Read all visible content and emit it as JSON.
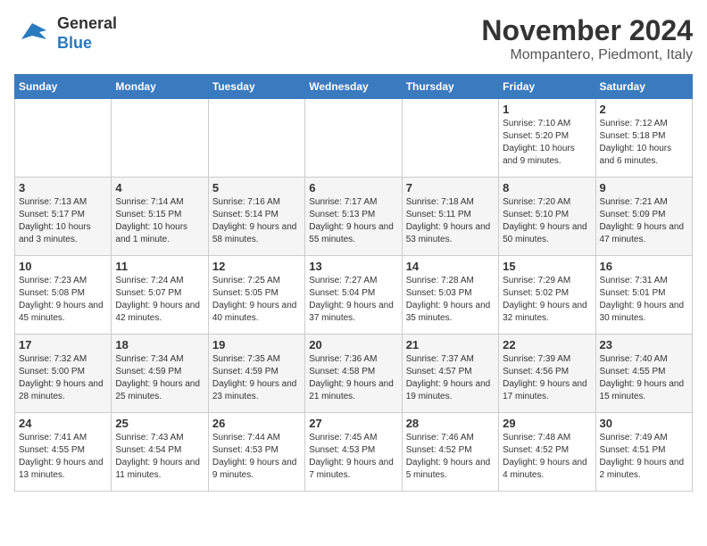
{
  "header": {
    "logo_general": "General",
    "logo_blue": "Blue",
    "month_title": "November 2024",
    "location": "Mompantero, Piedmont, Italy"
  },
  "days_of_week": [
    "Sunday",
    "Monday",
    "Tuesday",
    "Wednesday",
    "Thursday",
    "Friday",
    "Saturday"
  ],
  "weeks": [
    {
      "days": [
        {
          "num": "",
          "info": ""
        },
        {
          "num": "",
          "info": ""
        },
        {
          "num": "",
          "info": ""
        },
        {
          "num": "",
          "info": ""
        },
        {
          "num": "",
          "info": ""
        },
        {
          "num": "1",
          "info": "Sunrise: 7:10 AM\nSunset: 5:20 PM\nDaylight: 10 hours and 9 minutes."
        },
        {
          "num": "2",
          "info": "Sunrise: 7:12 AM\nSunset: 5:18 PM\nDaylight: 10 hours and 6 minutes."
        }
      ]
    },
    {
      "days": [
        {
          "num": "3",
          "info": "Sunrise: 7:13 AM\nSunset: 5:17 PM\nDaylight: 10 hours and 3 minutes."
        },
        {
          "num": "4",
          "info": "Sunrise: 7:14 AM\nSunset: 5:15 PM\nDaylight: 10 hours and 1 minute."
        },
        {
          "num": "5",
          "info": "Sunrise: 7:16 AM\nSunset: 5:14 PM\nDaylight: 9 hours and 58 minutes."
        },
        {
          "num": "6",
          "info": "Sunrise: 7:17 AM\nSunset: 5:13 PM\nDaylight: 9 hours and 55 minutes."
        },
        {
          "num": "7",
          "info": "Sunrise: 7:18 AM\nSunset: 5:11 PM\nDaylight: 9 hours and 53 minutes."
        },
        {
          "num": "8",
          "info": "Sunrise: 7:20 AM\nSunset: 5:10 PM\nDaylight: 9 hours and 50 minutes."
        },
        {
          "num": "9",
          "info": "Sunrise: 7:21 AM\nSunset: 5:09 PM\nDaylight: 9 hours and 47 minutes."
        }
      ]
    },
    {
      "days": [
        {
          "num": "10",
          "info": "Sunrise: 7:23 AM\nSunset: 5:08 PM\nDaylight: 9 hours and 45 minutes."
        },
        {
          "num": "11",
          "info": "Sunrise: 7:24 AM\nSunset: 5:07 PM\nDaylight: 9 hours and 42 minutes."
        },
        {
          "num": "12",
          "info": "Sunrise: 7:25 AM\nSunset: 5:05 PM\nDaylight: 9 hours and 40 minutes."
        },
        {
          "num": "13",
          "info": "Sunrise: 7:27 AM\nSunset: 5:04 PM\nDaylight: 9 hours and 37 minutes."
        },
        {
          "num": "14",
          "info": "Sunrise: 7:28 AM\nSunset: 5:03 PM\nDaylight: 9 hours and 35 minutes."
        },
        {
          "num": "15",
          "info": "Sunrise: 7:29 AM\nSunset: 5:02 PM\nDaylight: 9 hours and 32 minutes."
        },
        {
          "num": "16",
          "info": "Sunrise: 7:31 AM\nSunset: 5:01 PM\nDaylight: 9 hours and 30 minutes."
        }
      ]
    },
    {
      "days": [
        {
          "num": "17",
          "info": "Sunrise: 7:32 AM\nSunset: 5:00 PM\nDaylight: 9 hours and 28 minutes."
        },
        {
          "num": "18",
          "info": "Sunrise: 7:34 AM\nSunset: 4:59 PM\nDaylight: 9 hours and 25 minutes."
        },
        {
          "num": "19",
          "info": "Sunrise: 7:35 AM\nSunset: 4:59 PM\nDaylight: 9 hours and 23 minutes."
        },
        {
          "num": "20",
          "info": "Sunrise: 7:36 AM\nSunset: 4:58 PM\nDaylight: 9 hours and 21 minutes."
        },
        {
          "num": "21",
          "info": "Sunrise: 7:37 AM\nSunset: 4:57 PM\nDaylight: 9 hours and 19 minutes."
        },
        {
          "num": "22",
          "info": "Sunrise: 7:39 AM\nSunset: 4:56 PM\nDaylight: 9 hours and 17 minutes."
        },
        {
          "num": "23",
          "info": "Sunrise: 7:40 AM\nSunset: 4:55 PM\nDaylight: 9 hours and 15 minutes."
        }
      ]
    },
    {
      "days": [
        {
          "num": "24",
          "info": "Sunrise: 7:41 AM\nSunset: 4:55 PM\nDaylight: 9 hours and 13 minutes."
        },
        {
          "num": "25",
          "info": "Sunrise: 7:43 AM\nSunset: 4:54 PM\nDaylight: 9 hours and 11 minutes."
        },
        {
          "num": "26",
          "info": "Sunrise: 7:44 AM\nSunset: 4:53 PM\nDaylight: 9 hours and 9 minutes."
        },
        {
          "num": "27",
          "info": "Sunrise: 7:45 AM\nSunset: 4:53 PM\nDaylight: 9 hours and 7 minutes."
        },
        {
          "num": "28",
          "info": "Sunrise: 7:46 AM\nSunset: 4:52 PM\nDaylight: 9 hours and 5 minutes."
        },
        {
          "num": "29",
          "info": "Sunrise: 7:48 AM\nSunset: 4:52 PM\nDaylight: 9 hours and 4 minutes."
        },
        {
          "num": "30",
          "info": "Sunrise: 7:49 AM\nSunset: 4:51 PM\nDaylight: 9 hours and 2 minutes."
        }
      ]
    }
  ]
}
